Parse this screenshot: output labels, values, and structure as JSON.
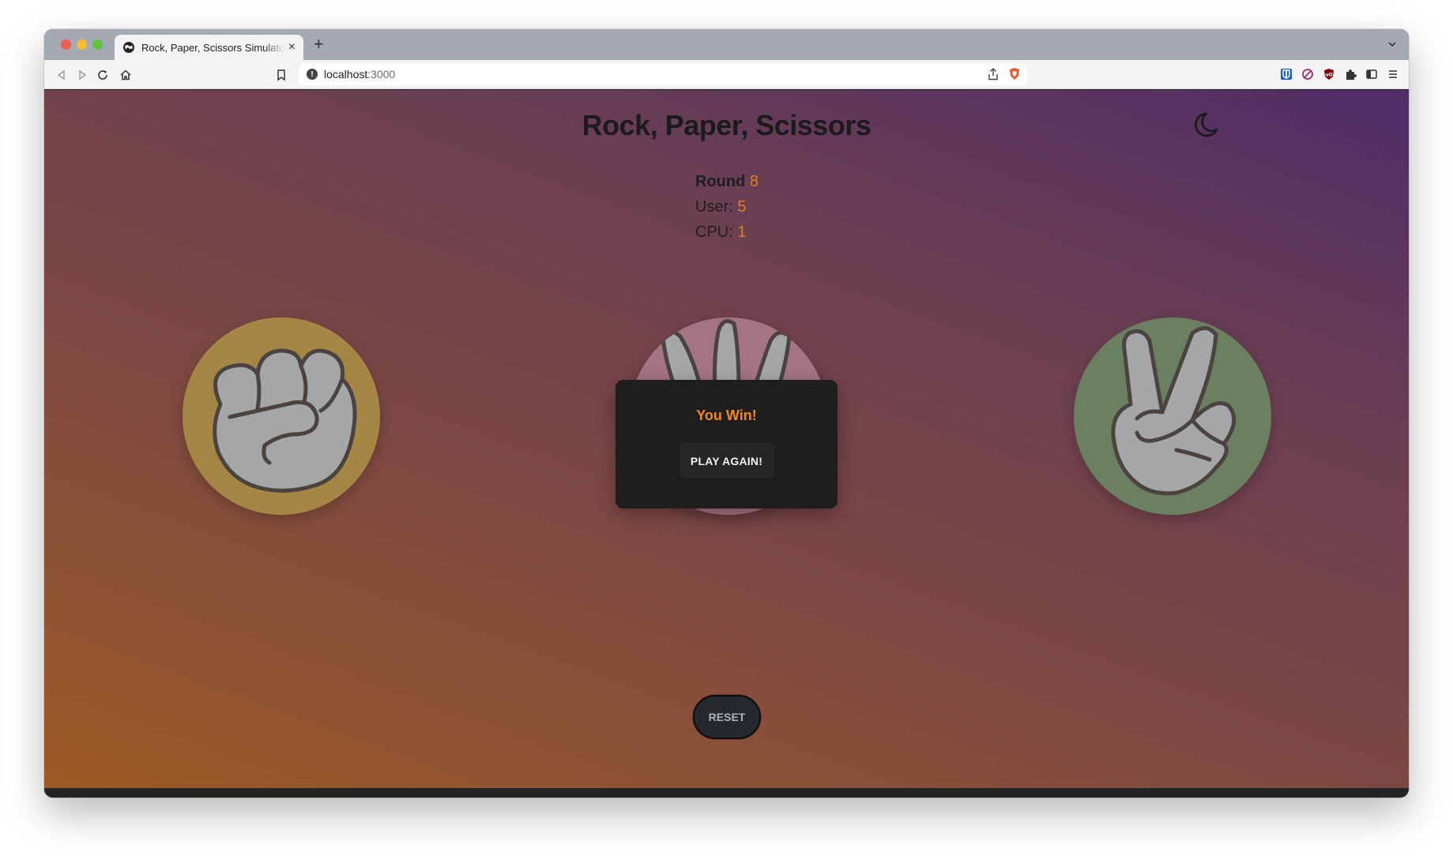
{
  "browser": {
    "tab_title": "Rock, Paper, Scissors Simulator",
    "tab_close": "×",
    "new_tab": "+",
    "url_host": "localhost",
    "url_port": ":3000"
  },
  "page": {
    "title": "Rock, Paper, Scissors",
    "theme_icon": "moon-icon"
  },
  "scoreboard": {
    "round_label": "Round",
    "round_value": "8",
    "user_label": "User:",
    "user_value": "5",
    "cpu_label": "CPU:",
    "cpu_value": "1"
  },
  "choices": [
    {
      "name": "rock",
      "icon": "fist-hand-icon",
      "color": "#a68645"
    },
    {
      "name": "paper",
      "icon": "open-hand-icon",
      "color": "#a57484"
    },
    {
      "name": "scissors",
      "icon": "peace-hand-icon",
      "color": "#6a8060"
    }
  ],
  "result_modal": {
    "title": "You Win!",
    "button_label": "PLAY AGAIN!"
  },
  "controls": {
    "reset_label": "RESET"
  },
  "colors": {
    "accent": "#e57a1f",
    "modal_bg": "#1e1e1e",
    "gradient_start": "#4f2d68",
    "gradient_end": "#9d5a24"
  }
}
